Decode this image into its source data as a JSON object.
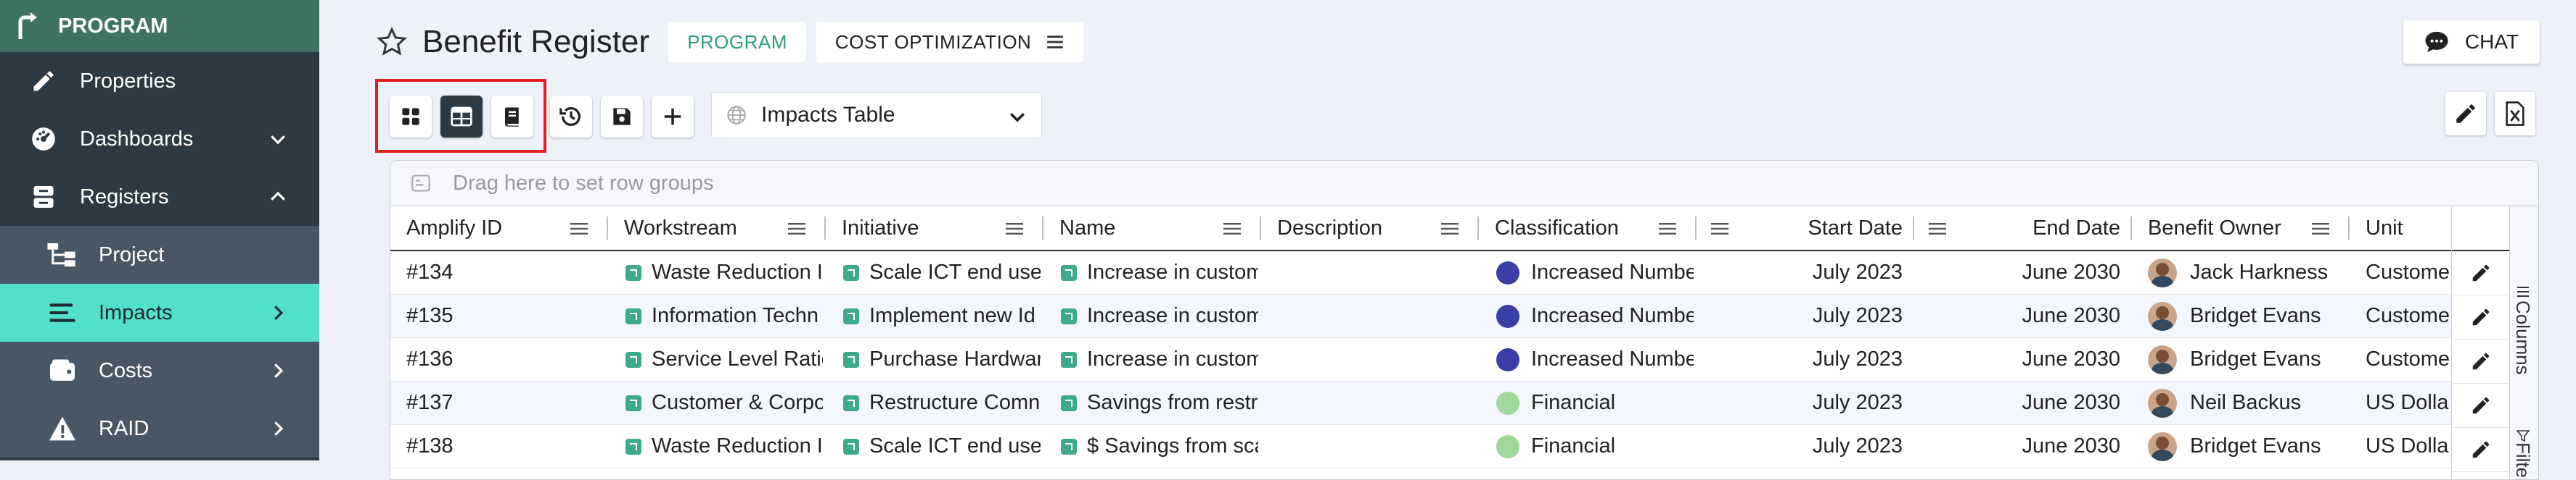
{
  "sidebar": {
    "brand": "PROGRAM",
    "items": [
      {
        "label": "Properties",
        "icon": "pencil-icon"
      },
      {
        "label": "Dashboards",
        "icon": "gauge-icon"
      },
      {
        "label": "Registers",
        "icon": "registers-icon"
      },
      {
        "label": "Project",
        "icon": "project-icon"
      },
      {
        "label": "Impacts",
        "icon": "list-icon"
      },
      {
        "label": "Costs",
        "icon": "wallet-icon"
      },
      {
        "label": "RAID",
        "icon": "warning-icon"
      }
    ]
  },
  "header": {
    "title": "Benefit Register",
    "badge_program": "PROGRAM",
    "badge_cost": "COST OPTIMIZATION",
    "chat_label": "CHAT"
  },
  "toolbar": {
    "view_name": "Impacts Table"
  },
  "grid": {
    "group_placeholder": "Drag here to set row groups",
    "columns": [
      "Amplify ID",
      "Workstream",
      "Initiative",
      "Name",
      "Description",
      "Classification",
      "",
      "Start Date",
      "End Date",
      "Benefit Owner",
      "Unit"
    ],
    "rows": [
      {
        "id": "#134",
        "workstream": "Waste Reduction I",
        "initiative": "Scale ICT end user",
        "name": "Increase in custom",
        "description": "",
        "classification": "Increased Numbe",
        "class_color": "#3a3fa8",
        "start": "July 2023",
        "end": "June 2030",
        "owner": "Jack Harkness",
        "unit": "Custome"
      },
      {
        "id": "#135",
        "workstream": "Information Techn",
        "initiative": "Implement new Id",
        "name": "Increase in custom",
        "description": "",
        "classification": "Increased Numbe",
        "class_color": "#3a3fa8",
        "start": "July 2023",
        "end": "June 2030",
        "owner": "Bridget Evans",
        "unit": "Custome"
      },
      {
        "id": "#136",
        "workstream": "Service Level Ratic",
        "initiative": "Purchase Hardwar",
        "name": "Increase in custom",
        "description": "",
        "classification": "Increased Numbe",
        "class_color": "#3a3fa8",
        "start": "July 2023",
        "end": "June 2030",
        "owner": "Bridget Evans",
        "unit": "Custome"
      },
      {
        "id": "#137",
        "workstream": "Customer & Corpo",
        "initiative": "Restructure Comn",
        "name": "Savings from restr",
        "description": "",
        "classification": "Financial",
        "class_color": "#9fd89a",
        "start": "July 2023",
        "end": "June 2030",
        "owner": "Neil Backus",
        "unit": "US Dolla"
      },
      {
        "id": "#138",
        "workstream": "Waste Reduction I",
        "initiative": "Scale ICT end user",
        "name": "$ Savings from sca",
        "description": "",
        "classification": "Financial",
        "class_color": "#9fd89a",
        "start": "July 2023",
        "end": "June 2030",
        "owner": "Bridget Evans",
        "unit": "US Dolla"
      }
    ],
    "side_tabs": [
      "Columns",
      "Filters"
    ]
  }
}
